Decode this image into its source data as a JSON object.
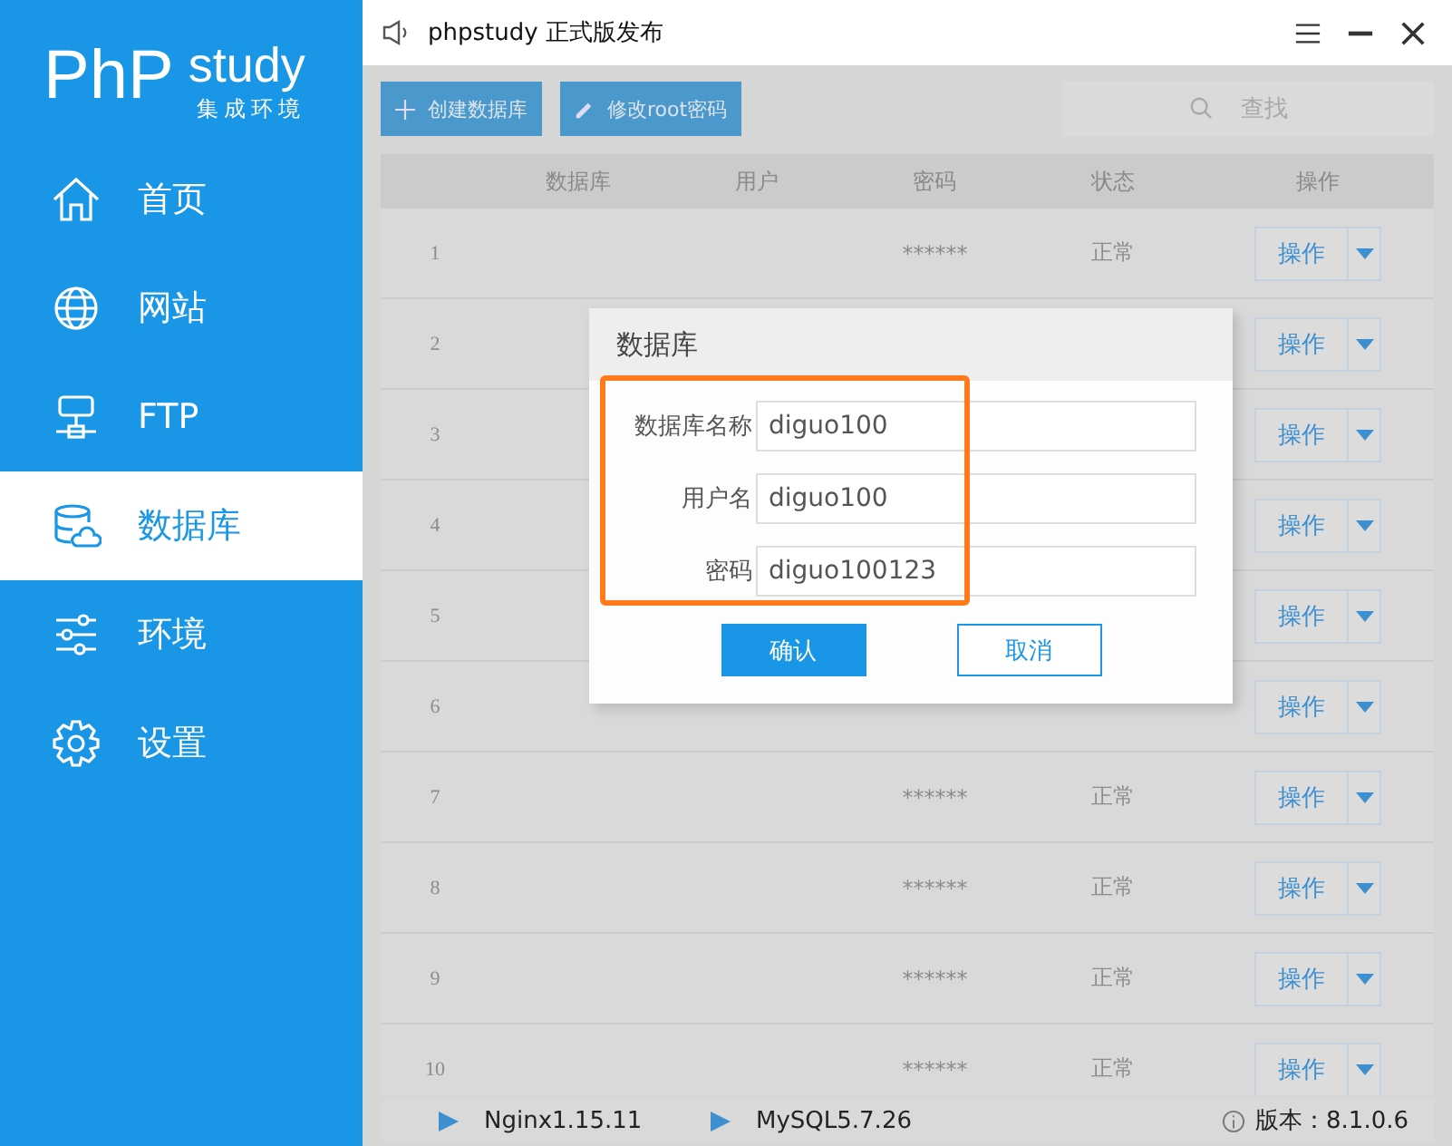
{
  "logo": {
    "brand": "PhP",
    "word": "study",
    "tagline": "集成环境"
  },
  "sidebar": {
    "items": [
      {
        "label": "首页",
        "selected": false
      },
      {
        "label": "网站",
        "selected": false
      },
      {
        "label": "FTP",
        "selected": false
      },
      {
        "label": "数据库",
        "selected": true
      },
      {
        "label": "环境",
        "selected": false
      },
      {
        "label": "设置",
        "selected": false
      }
    ]
  },
  "window": {
    "title": "phpstudy 正式版发布"
  },
  "toolbar": {
    "create_button": "创建数据库",
    "root_button": "修改root密码",
    "search": {
      "placeholder": "查找"
    }
  },
  "table": {
    "columns": [
      "数据库",
      "用户",
      "密码",
      "状态",
      "操作"
    ],
    "rows": [
      {
        "index": "1",
        "password": "******",
        "status": "正常",
        "action": "操作"
      },
      {
        "index": "2",
        "action": "操作"
      },
      {
        "index": "3",
        "action": "操作"
      },
      {
        "index": "4",
        "action": "操作"
      },
      {
        "index": "5",
        "action": "操作"
      },
      {
        "index": "6",
        "action": "操作"
      },
      {
        "index": "7",
        "password": "******",
        "status": "正常",
        "action": "操作"
      },
      {
        "index": "8",
        "password": "******",
        "status": "正常",
        "action": "操作"
      },
      {
        "index": "9",
        "password": "******",
        "status": "正常",
        "action": "操作"
      },
      {
        "index": "10",
        "password": "******",
        "status": "正常",
        "action": "操作"
      }
    ]
  },
  "dialog": {
    "title": "数据库",
    "fields": [
      {
        "label": "数据库名称",
        "value": "diguo100"
      },
      {
        "label": "用户名",
        "value": "diguo100"
      },
      {
        "label": "密码",
        "value": "diguo100123"
      }
    ],
    "confirm": "确认",
    "cancel": "取消"
  },
  "status_bar": {
    "services": [
      "Nginx1.15.11",
      "MySQL5.7.26"
    ],
    "version": "版本：8.1.0.6"
  }
}
